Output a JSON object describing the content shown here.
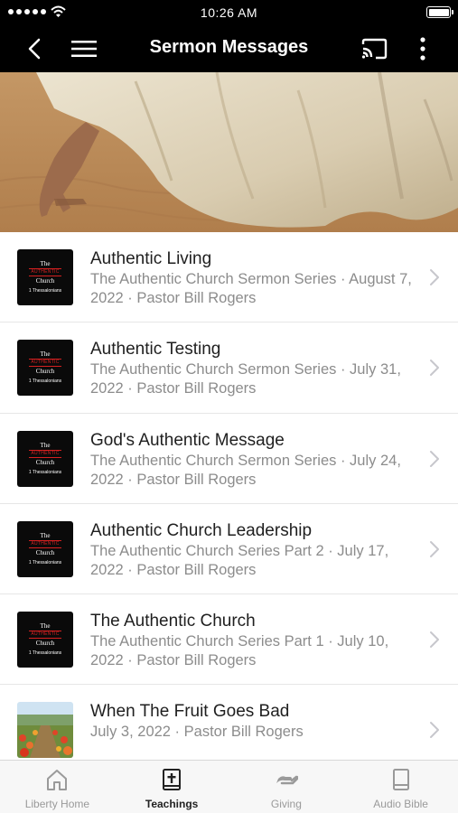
{
  "status_bar": {
    "time": "10:26 AM"
  },
  "nav": {
    "title": "Sermon Messages",
    "icons": [
      "back-chevron-icon",
      "hamburger-menu-icon",
      "cast-icon",
      "more-vertical-icon"
    ]
  },
  "thumb_art": {
    "line1": "The",
    "line2": "AUTHENTIC",
    "line3": "Church",
    "line4": "1 Thessalonians"
  },
  "sermons": [
    {
      "title": "Authentic Living",
      "subtitle": "The Authentic Church Sermon Series · August 7, 2022 · Pastor Bill Rogers"
    },
    {
      "title": "Authentic Testing",
      "subtitle": "The Authentic Church Sermon Series · July 31, 2022 · Pastor Bill Rogers"
    },
    {
      "title": "God's Authentic Message",
      "subtitle": "The Authentic Church Sermon Series · July 24, 2022 · Pastor Bill Rogers"
    },
    {
      "title": "Authentic Church Leadership",
      "subtitle": "The Authentic Church Series Part 2 · July 17, 2022 · Pastor Bill Rogers"
    },
    {
      "title": "The Authentic Church",
      "subtitle": "The Authentic Church Series Part 1 · July 10, 2022 · Pastor Bill Rogers"
    },
    {
      "title": "When The Fruit Goes Bad",
      "subtitle": "July 3, 2022 · Pastor Bill Rogers"
    }
  ],
  "tabs": [
    {
      "label": "Liberty Home",
      "icon": "home-icon",
      "active": false
    },
    {
      "label": "Teachings",
      "icon": "bible-icon",
      "active": true
    },
    {
      "label": "Giving",
      "icon": "giving-hand-icon",
      "active": false
    },
    {
      "label": "Audio Bible",
      "icon": "book-icon",
      "active": false
    }
  ],
  "colors": {
    "bar_background": "#000000",
    "thumb_accent": "#d62020",
    "tab_active": "#222222",
    "tab_inactive": "#9a9a9a"
  }
}
